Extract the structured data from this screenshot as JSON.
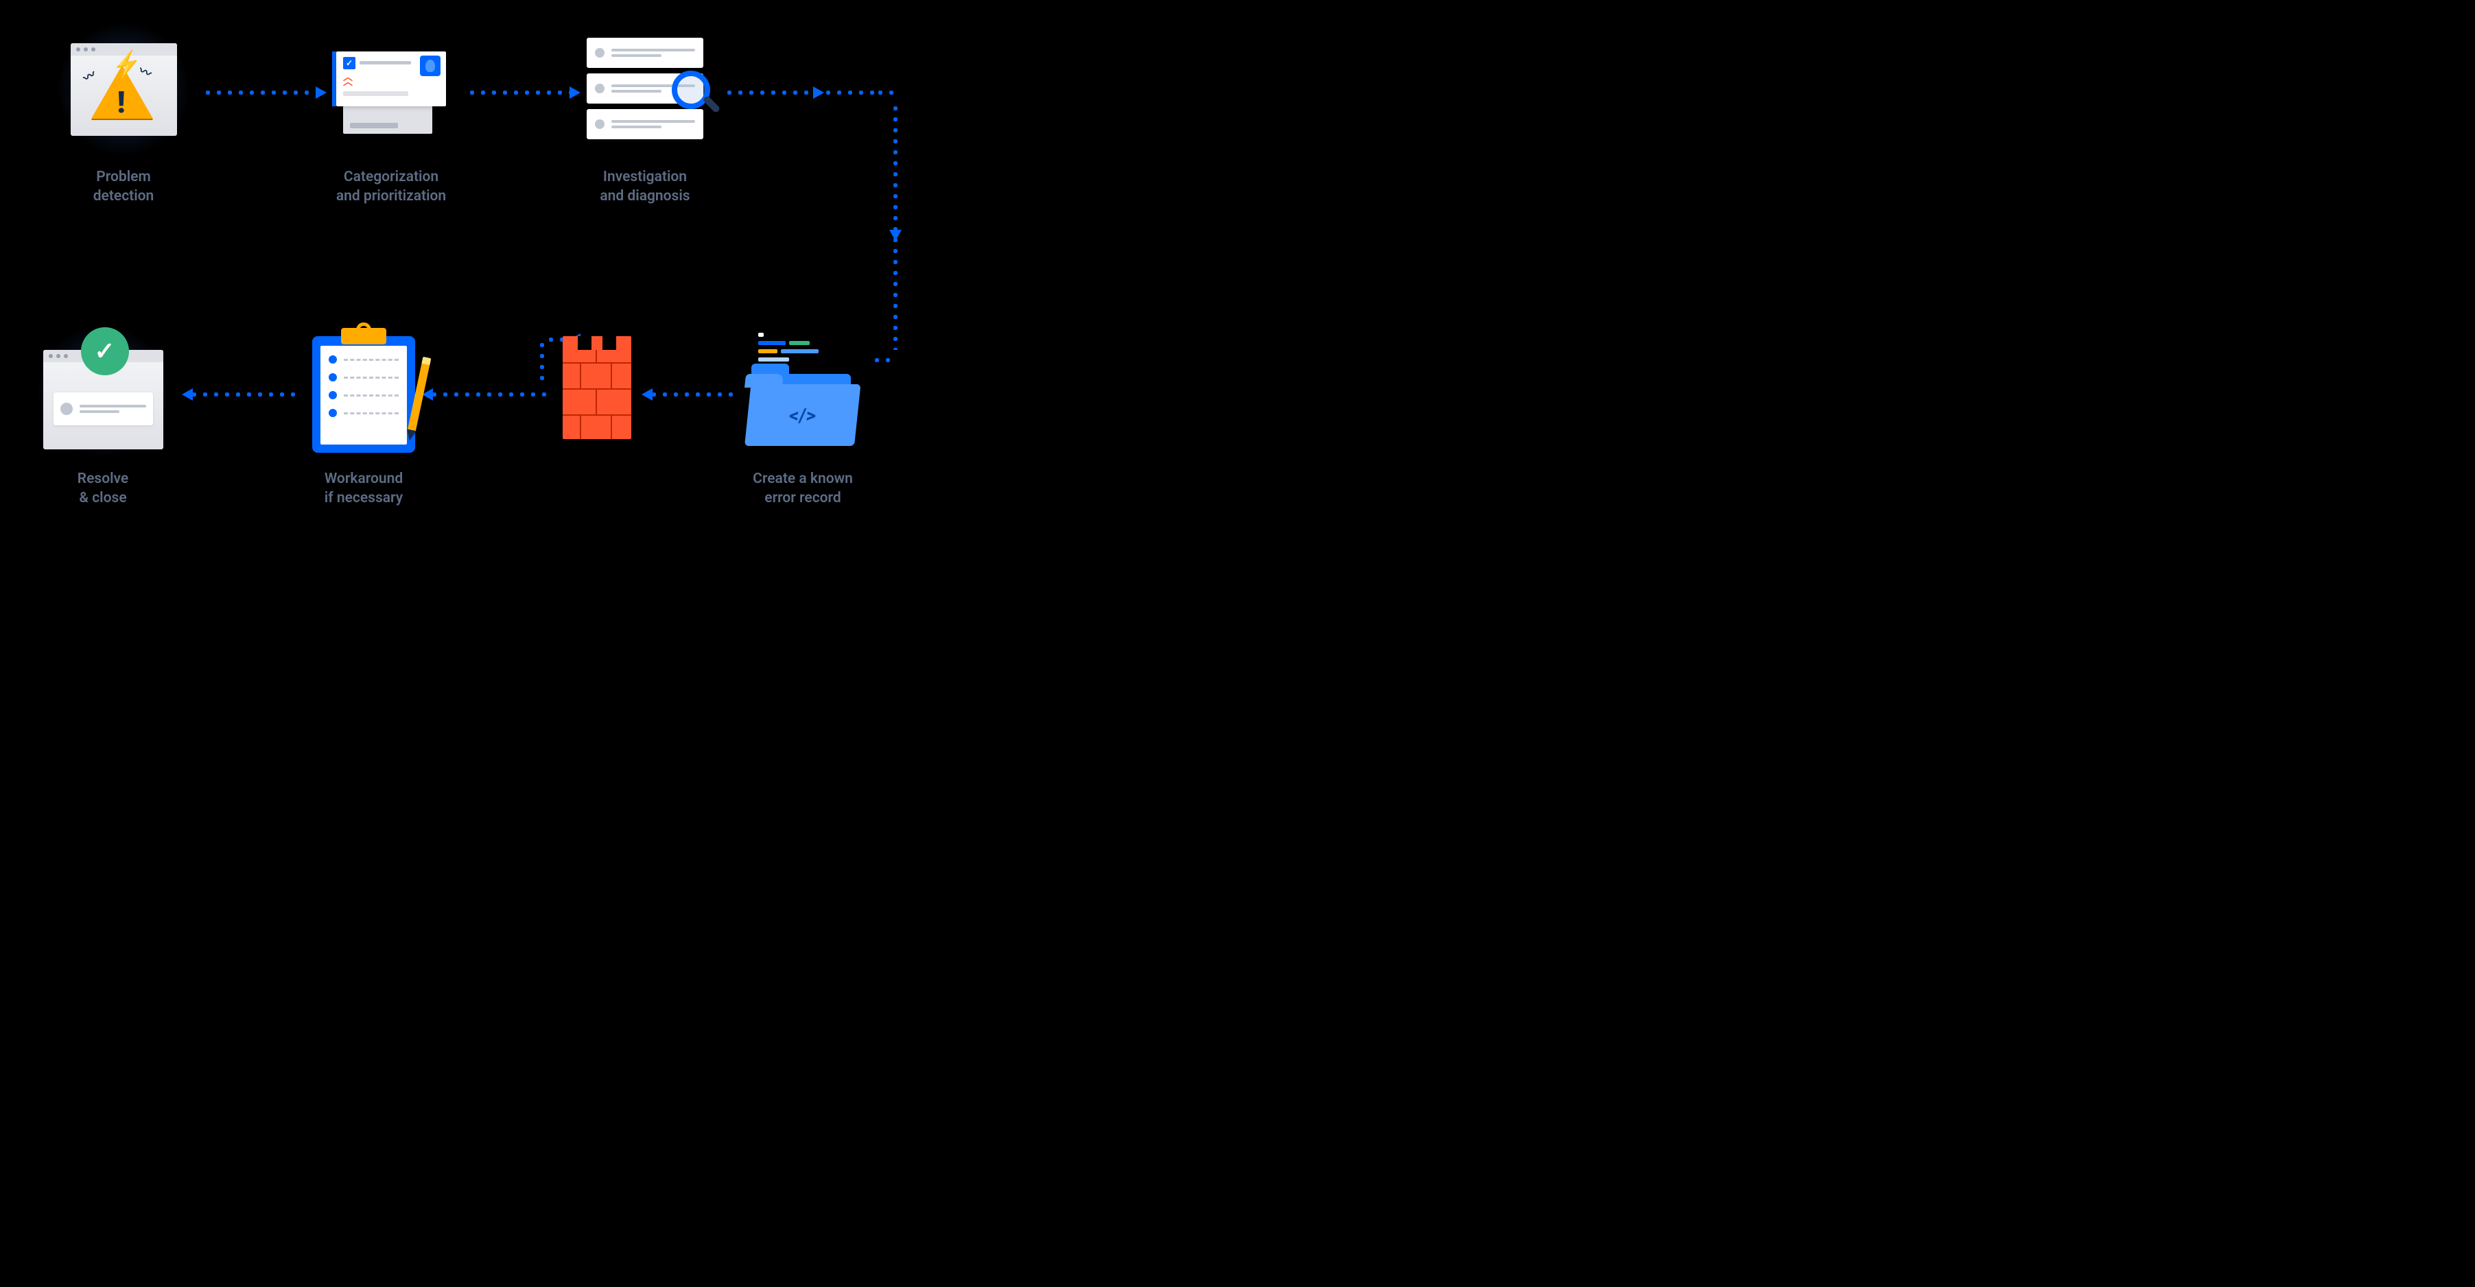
{
  "steps": {
    "s1": {
      "label": "Problem\ndetection",
      "icon": "warning-browser-icon"
    },
    "s2": {
      "label": "Categorization\nand prioritization",
      "icon": "priority-card-icon"
    },
    "s3": {
      "label": "Investigation\nand diagnosis",
      "icon": "search-list-icon"
    },
    "s4": {
      "label": "Create a known\nerror record",
      "icon": "code-folder-icon"
    },
    "s5": {
      "label": "",
      "icon": "brick-wall-icon"
    },
    "s6": {
      "label": "Workaround\nif necessary",
      "icon": "clipboard-checklist-icon"
    },
    "s7": {
      "label": "Resolve\n& close",
      "icon": "success-browser-icon"
    }
  },
  "flow_order": [
    "s1",
    "s2",
    "s3",
    "s4",
    "s5",
    "s6",
    "s7"
  ],
  "colors": {
    "arrow": "#0065ff",
    "label": "#5e6c84",
    "warning": "#ffab00",
    "danger": "#ff5630",
    "success": "#36b37e"
  }
}
